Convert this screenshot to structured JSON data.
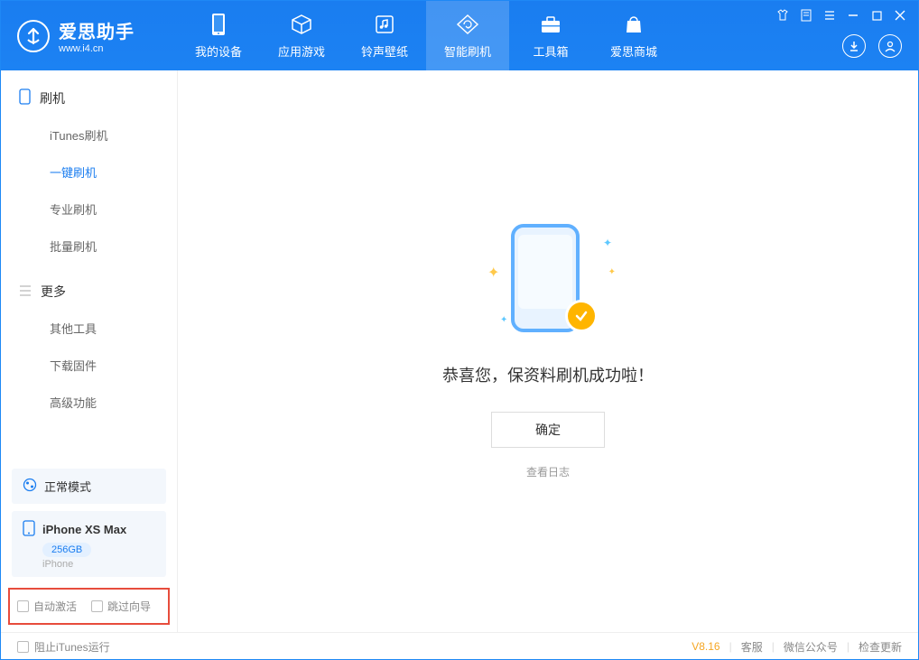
{
  "app": {
    "name_cn": "爱思助手",
    "name_en": "www.i4.cn"
  },
  "nav": {
    "items": [
      {
        "label": "我的设备"
      },
      {
        "label": "应用游戏"
      },
      {
        "label": "铃声壁纸"
      },
      {
        "label": "智能刷机"
      },
      {
        "label": "工具箱"
      },
      {
        "label": "爱思商城"
      }
    ]
  },
  "sidebar": {
    "section1_title": "刷机",
    "items1": [
      {
        "label": "iTunes刷机"
      },
      {
        "label": "一键刷机"
      },
      {
        "label": "专业刷机"
      },
      {
        "label": "批量刷机"
      }
    ],
    "section2_title": "更多",
    "items2": [
      {
        "label": "其他工具"
      },
      {
        "label": "下载固件"
      },
      {
        "label": "高级功能"
      }
    ]
  },
  "device": {
    "mode_label": "正常模式",
    "name": "iPhone XS Max",
    "storage": "256GB",
    "type": "iPhone"
  },
  "checks": {
    "auto_activate": "自动激活",
    "skip_guide": "跳过向导"
  },
  "main": {
    "success_msg": "恭喜您，保资料刷机成功啦！",
    "ok_btn": "确定",
    "view_log": "查看日志"
  },
  "footer": {
    "block_itunes": "阻止iTunes运行",
    "version": "V8.16",
    "support": "客服",
    "wechat": "微信公众号",
    "check_update": "检查更新"
  }
}
